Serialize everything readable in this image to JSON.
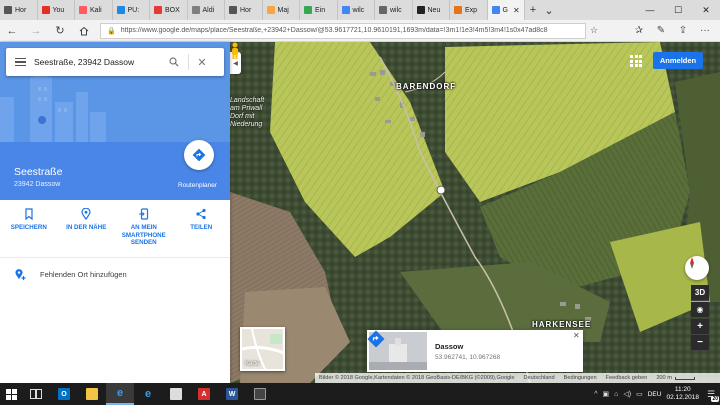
{
  "browser": {
    "tabs": [
      {
        "title": "Hor",
        "fav_color": "#555555"
      },
      {
        "title": "You",
        "fav_color": "#e52d27"
      },
      {
        "title": "Kali",
        "fav_color": "#ff5a5f"
      },
      {
        "title": "PU:",
        "fav_color": "#1e88e5"
      },
      {
        "title": "BOX",
        "fav_color": "#e53935"
      },
      {
        "title": "Aldi",
        "fav_color": "#7f7f7f"
      },
      {
        "title": "Hor",
        "fav_color": "#555555"
      },
      {
        "title": "Maj",
        "fav_color": "#f4a742"
      },
      {
        "title": "Ein",
        "fav_color": "#34a853"
      },
      {
        "title": "wilc",
        "fav_color": "#4285f4"
      },
      {
        "title": "wilc",
        "fav_color": "#666666"
      },
      {
        "title": "Neu",
        "fav_color": "#222222"
      },
      {
        "title": "Exp",
        "fav_color": "#e8711c"
      },
      {
        "title": "G",
        "fav_color": "#4285f4",
        "active": true
      }
    ],
    "url": "https://www.google.de/maps/place/Seestraße,+23942+Dassow/@53.9617721,10.9610191,1693m/data=!3m1!1e3!4m5!3m4!1s0x47ad8c8"
  },
  "search": {
    "value": "Seestraße, 23942 Dassow"
  },
  "place": {
    "title": "Seestraße",
    "subtitle": "23942 Dassow",
    "route_label": "Routenplaner",
    "actions": [
      {
        "label": "SPEICHERN",
        "icon": "bookmark-icon"
      },
      {
        "label": "IN DER NÄHE",
        "icon": "nearby-pin-icon"
      },
      {
        "label": "AN MEIN SMARTPHONE SENDEN",
        "icon": "send-to-phone-icon"
      },
      {
        "label": "TEILEN",
        "icon": "share-icon"
      }
    ],
    "add_missing": "Fehlenden Ort hinzufügen"
  },
  "map": {
    "signin": "Anmelden",
    "labels": {
      "village1": "BARENDORF",
      "village2": "HARKENSEE",
      "reserve": "Landschaft\nam Priwall\nDorf mit\nNiederung"
    },
    "layer_label": "Karte",
    "info_card": {
      "title": "Dassow",
      "coords": "53.962741, 10.967268"
    },
    "footer": {
      "imagery": "Bilder © 2018 Google,Kartendaten © 2018 GeoBasis-DE/BKG (©2009),Google",
      "country": "Deutschland",
      "terms": "Bedingungen",
      "feedback": "Feedback geben",
      "scale": "200 m"
    },
    "controls": {
      "threeD": "3D",
      "zoom_in": "+",
      "zoom_out": "−"
    }
  },
  "taskbar": {
    "lang": "DEU",
    "time": "11:20",
    "date": "02.12.2018",
    "notifications": "20"
  },
  "colors": {
    "accent": "#4a86e8",
    "link_blue": "#1a73e8"
  }
}
